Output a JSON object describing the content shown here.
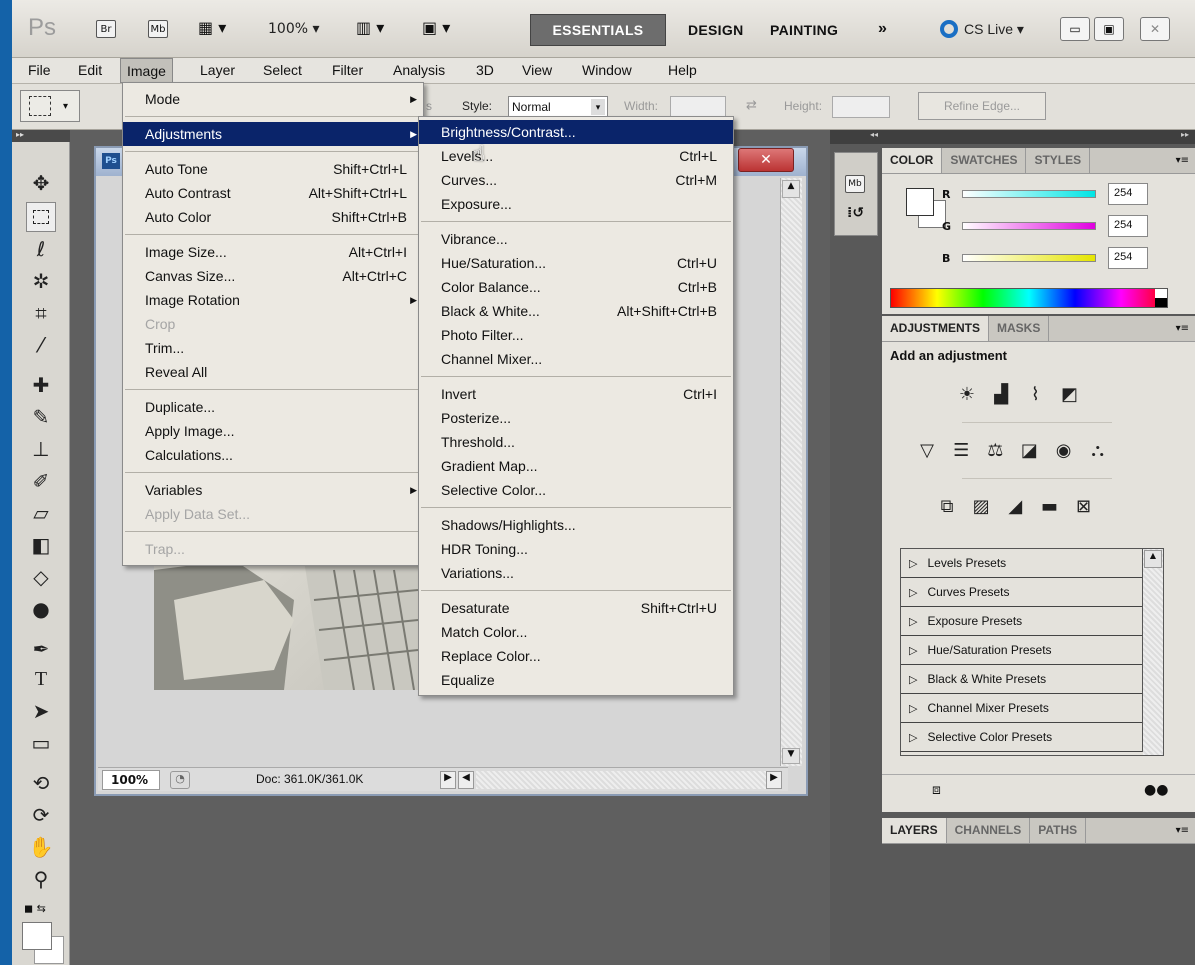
{
  "appbar": {
    "logo": "Ps",
    "br": "Br",
    "mb": "Mb",
    "zoom": "100%",
    "workspaces": [
      "ESSENTIALS",
      "DESIGN",
      "PAINTING"
    ],
    "more": "»",
    "cslive": "CS Live"
  },
  "menubar": [
    "File",
    "Edit",
    "Image",
    "Layer",
    "Select",
    "Filter",
    "Analysis",
    "3D",
    "View",
    "Window",
    "Help"
  ],
  "options": {
    "style_label": "Style:",
    "style_value": "Normal",
    "width_label": "Width:",
    "height_label": "Height:",
    "refine": "Refine Edge...",
    "partial": "s"
  },
  "doc": {
    "zoom": "100%",
    "status": "Doc: 361.0K/361.0K",
    "tab_label": "Ps"
  },
  "image_menu": [
    {
      "label": "Mode",
      "submenu": true
    },
    {
      "sep": true
    },
    {
      "label": "Adjustments",
      "submenu": true,
      "highlight": true
    },
    {
      "sep": true
    },
    {
      "label": "Auto Tone",
      "shortcut": "Shift+Ctrl+L"
    },
    {
      "label": "Auto Contrast",
      "shortcut": "Alt+Shift+Ctrl+L"
    },
    {
      "label": "Auto Color",
      "shortcut": "Shift+Ctrl+B"
    },
    {
      "sep": true
    },
    {
      "label": "Image Size...",
      "shortcut": "Alt+Ctrl+I"
    },
    {
      "label": "Canvas Size...",
      "shortcut": "Alt+Ctrl+C"
    },
    {
      "label": "Image Rotation",
      "submenu": true
    },
    {
      "label": "Crop",
      "disabled": true
    },
    {
      "label": "Trim..."
    },
    {
      "label": "Reveal All"
    },
    {
      "sep": true
    },
    {
      "label": "Duplicate..."
    },
    {
      "label": "Apply Image..."
    },
    {
      "label": "Calculations..."
    },
    {
      "sep": true
    },
    {
      "label": "Variables",
      "submenu": true
    },
    {
      "label": "Apply Data Set...",
      "disabled": true
    },
    {
      "sep": true
    },
    {
      "label": "Trap...",
      "disabled": true
    }
  ],
  "adjust_menu": [
    {
      "label": "Brightness/Contrast...",
      "highlight": true
    },
    {
      "label": "Levels...",
      "shortcut": "Ctrl+L"
    },
    {
      "label": "Curves...",
      "shortcut": "Ctrl+M"
    },
    {
      "label": "Exposure..."
    },
    {
      "sep": true
    },
    {
      "label": "Vibrance..."
    },
    {
      "label": "Hue/Saturation...",
      "shortcut": "Ctrl+U"
    },
    {
      "label": "Color Balance...",
      "shortcut": "Ctrl+B"
    },
    {
      "label": "Black & White...",
      "shortcut": "Alt+Shift+Ctrl+B"
    },
    {
      "label": "Photo Filter..."
    },
    {
      "label": "Channel Mixer..."
    },
    {
      "sep": true
    },
    {
      "label": "Invert",
      "shortcut": "Ctrl+I"
    },
    {
      "label": "Posterize..."
    },
    {
      "label": "Threshold..."
    },
    {
      "label": "Gradient Map..."
    },
    {
      "label": "Selective Color..."
    },
    {
      "sep": true
    },
    {
      "label": "Shadows/Highlights..."
    },
    {
      "label": "HDR Toning..."
    },
    {
      "label": "Variations..."
    },
    {
      "sep": true
    },
    {
      "label": "Desaturate",
      "shortcut": "Shift+Ctrl+U"
    },
    {
      "label": "Match Color..."
    },
    {
      "label": "Replace Color..."
    },
    {
      "label": "Equalize"
    }
  ],
  "color_panel": {
    "tabs": [
      "COLOR",
      "SWATCHES",
      "STYLES"
    ],
    "channels": [
      {
        "name": "R",
        "value": "254",
        "color": "#00e5e5"
      },
      {
        "name": "G",
        "value": "254",
        "color": "#e000e0"
      },
      {
        "name": "B",
        "value": "254",
        "color": "#e5e500"
      }
    ]
  },
  "adjust_panel": {
    "tabs": [
      "ADJUSTMENTS",
      "MASKS"
    ],
    "title": "Add an adjustment",
    "presets": [
      "Levels Presets",
      "Curves Presets",
      "Exposure Presets",
      "Hue/Saturation Presets",
      "Black & White Presets",
      "Channel Mixer Presets",
      "Selective Color Presets"
    ]
  },
  "layers_panel": {
    "tabs": [
      "LAYERS",
      "CHANNELS",
      "PATHS"
    ]
  }
}
